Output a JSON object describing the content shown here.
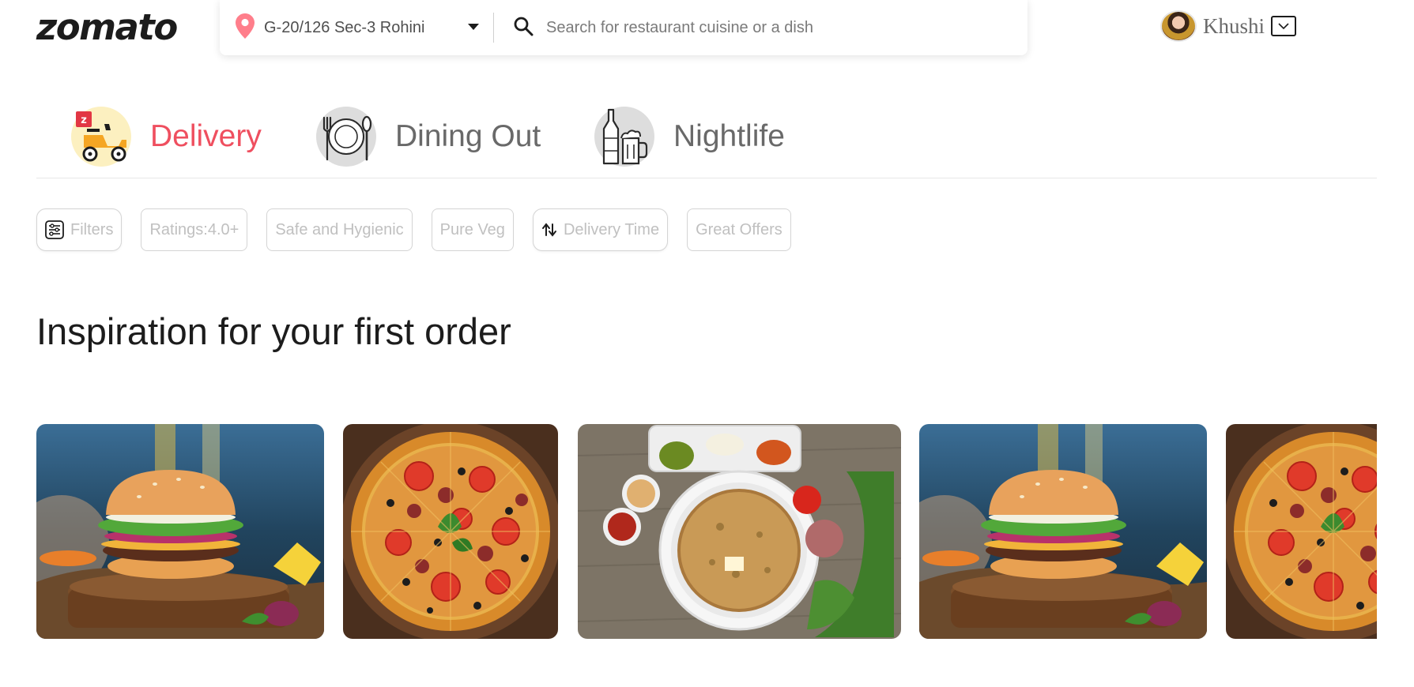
{
  "header": {
    "logo": "zomato",
    "location": "G-20/126 Sec-3 Rohini",
    "search_placeholder": "Search for restaurant cuisine or a dish",
    "user_name": "Khushi"
  },
  "tabs": [
    {
      "label": "Delivery",
      "icon": "scooter-icon",
      "active": true
    },
    {
      "label": "Dining Out",
      "icon": "plate-cutlery-icon",
      "active": false
    },
    {
      "label": "Nightlife",
      "icon": "bottle-beer-icon",
      "active": false
    }
  ],
  "filters": [
    {
      "label": "Filters",
      "icon": "filter-sliders-icon"
    },
    {
      "label": "Ratings:4.0+"
    },
    {
      "label": "Safe and Hygienic"
    },
    {
      "label": "Pure Veg"
    },
    {
      "label": "Delivery Time",
      "icon": "sort-arrows-icon"
    },
    {
      "label": "Great Offers"
    }
  ],
  "section_title": "Inspiration for your first order",
  "carousel_items": [
    {
      "image": "burger-image"
    },
    {
      "image": "pizza-image"
    },
    {
      "image": "paratha-thali-image"
    },
    {
      "image": "burger-image"
    },
    {
      "image": "pizza-image"
    }
  ],
  "colors": {
    "brand": "#ef4f5f",
    "text_dark": "#1c1c1c",
    "text_muted": "#696969",
    "chip_text": "#c0c0c0",
    "chip_border": "#d4d4d4"
  }
}
